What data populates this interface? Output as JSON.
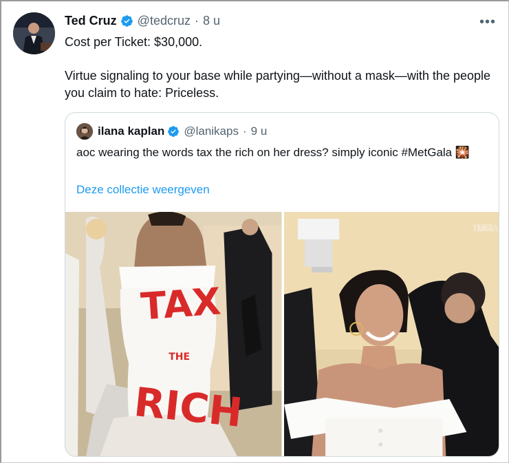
{
  "tweet": {
    "author_name": "Ted Cruz",
    "author_handle": "@tedcruz",
    "separator": "·",
    "time": "8 u",
    "more_label": "•••",
    "text_line1": "Cost per Ticket: $30,000.",
    "text_line2": "Virtue signaling to your base while partying—without a mask—with the people you claim to hate: Priceless."
  },
  "quote": {
    "author_name": "ilana kaplan",
    "author_handle": "@lanikaps",
    "separator": "·",
    "time": "9 u",
    "text": "aoc wearing the words tax the rich on her dress? simply iconic #MetGala 🎇",
    "collection_link": "Deze collectie weergeven"
  },
  "media": {
    "photo_left_dress_text_1": "TAX",
    "photo_left_dress_text_2": "THE",
    "photo_left_dress_text_3": "RICH",
    "photo_right_sign": "THE MET GALA"
  },
  "colors": {
    "verified_blue": "#1d9bf0",
    "link_blue": "#1d9bf0",
    "dress_red": "#d92a2a",
    "text_secondary": "#536471"
  },
  "icons": [
    "verified-badge-icon",
    "more-options-icon"
  ]
}
